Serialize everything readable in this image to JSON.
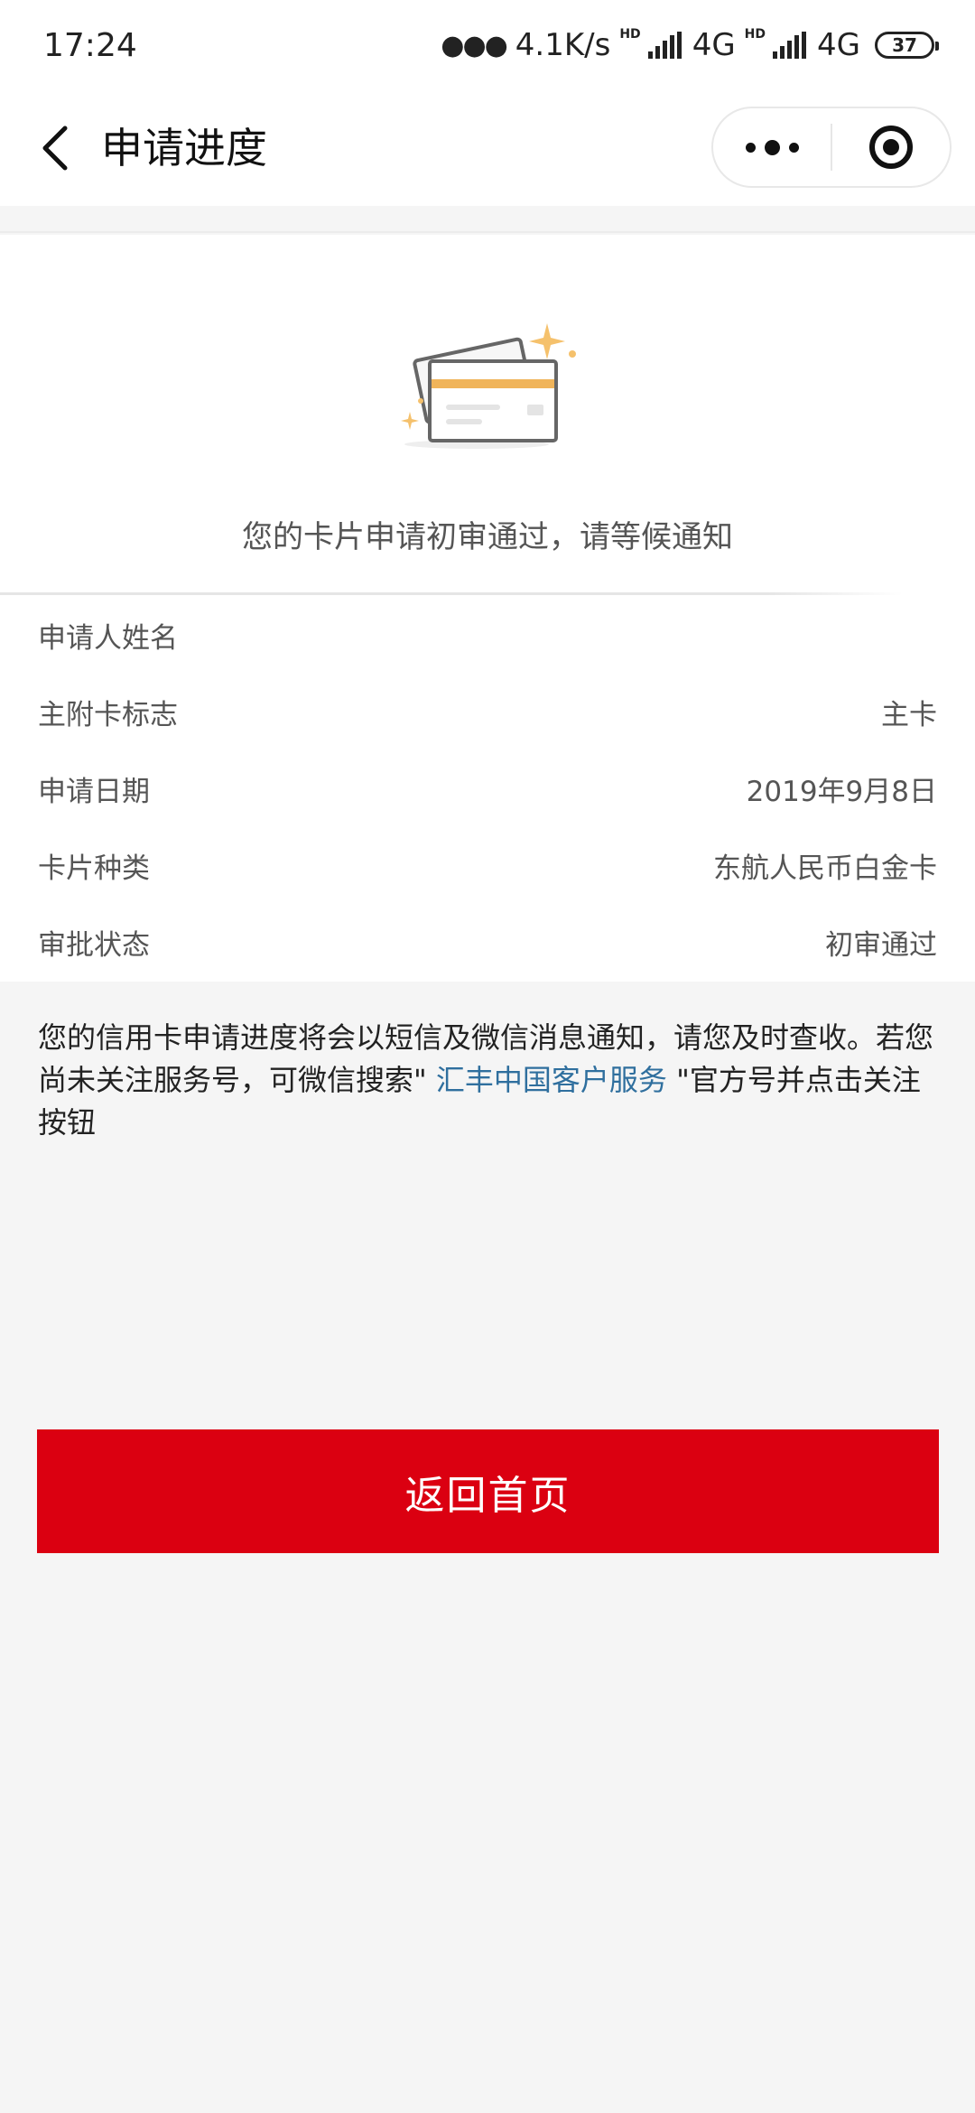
{
  "status_bar": {
    "time": "17:24",
    "network_speed": "4.1K/s",
    "hd_label": "HD",
    "net1": "4G",
    "net2": "4G",
    "battery": "37"
  },
  "nav": {
    "title": "申请进度"
  },
  "hero": {
    "message": "您的卡片申请初审通过，请等候通知"
  },
  "info": {
    "rows": [
      {
        "label": "申请人姓名",
        "value": ""
      },
      {
        "label": "主附卡标志",
        "value": "主卡"
      },
      {
        "label": "申请日期",
        "value": "2019年9月8日"
      },
      {
        "label": "卡片种类",
        "value": "东航人民币白金卡"
      },
      {
        "label": "审批状态",
        "value": "初审通过"
      }
    ]
  },
  "notice": {
    "text_before": "您的信用卡申请进度将会以短信及微信消息通知，请您及时查收。若您尚未关注服务号，可微信搜索\" ",
    "link": "汇丰中国客户服务",
    "text_after": " \"官方号并点击关注按钮"
  },
  "actions": {
    "home_label": "返回首页"
  },
  "colors": {
    "primary_red": "#db0011",
    "link_blue": "#2f6f9e",
    "card_stripe": "#f0b45a",
    "sparkle": "#f5c16c"
  },
  "icons": {
    "back": "chevron-left-icon",
    "more": "more-dots-icon",
    "close": "target-icon",
    "illustration": "credit-card-illustration"
  }
}
